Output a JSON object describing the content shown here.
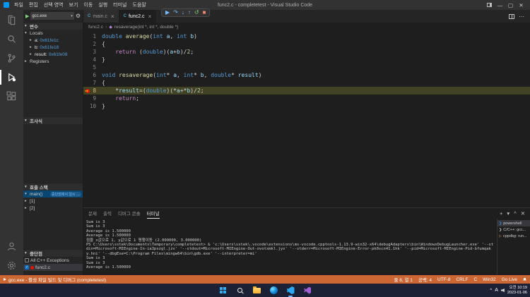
{
  "title_bar": {
    "menus": [
      "파일",
      "편집",
      "선택 영역",
      "보기",
      "이동",
      "실행",
      "터미널",
      "도움말"
    ],
    "title": "func2.c - completetest - Visual Studio Code"
  },
  "activity_bar": {
    "top": [
      {
        "name": "explorer",
        "active": false
      },
      {
        "name": "search",
        "active": false
      },
      {
        "name": "source-control",
        "active": false
      },
      {
        "name": "run-debug",
        "active": true
      },
      {
        "name": "extensions",
        "active": false
      }
    ],
    "bottom": [
      {
        "name": "account",
        "active": false
      },
      {
        "name": "settings",
        "active": false
      }
    ]
  },
  "debug_toolbar": {
    "buttons": [
      "continue",
      "step-over",
      "step-into",
      "step-out",
      "restart",
      "stop"
    ]
  },
  "sidebar": {
    "config": "gcc.exe",
    "variables": {
      "label": "변수",
      "locals_label": "Locals",
      "registers_label": "Registers",
      "locals": [
        {
          "name": "a",
          "value": "0x61fe1c"
        },
        {
          "name": "b",
          "value": "0x61fe18"
        },
        {
          "name": "result",
          "value": "0x61fe08"
        }
      ]
    },
    "watch": {
      "label": "조사식"
    },
    "call_stack": {
      "label": "호출 스택",
      "items": [
        {
          "label": "main()",
          "badge": "중단점에서 일시 중지됨",
          "selected": true
        },
        {
          "label": "[1]",
          "selected": false
        },
        {
          "label": "[2]",
          "selected": false
        }
      ]
    },
    "breakpoints": {
      "label": "중단점",
      "items": [
        {
          "label": "All C++ Exceptions",
          "checked": false,
          "dot": false,
          "selected": false
        },
        {
          "label": "func2.c",
          "checked": true,
          "dot": true,
          "selected": true
        }
      ]
    }
  },
  "editor": {
    "tabs": [
      {
        "label": "main.c",
        "active": false
      },
      {
        "label": "func2.c",
        "active": true
      }
    ],
    "breadcrumb": {
      "file": "func2.c",
      "symbol": "resaverage(int *, int *, double *)"
    },
    "code": {
      "current_line": 8,
      "breakpoint_line": 8,
      "lines": [
        [
          {
            "t": "double",
            "c": "kw"
          },
          {
            "t": " ",
            "c": "pl"
          },
          {
            "t": "average",
            "c": "fn"
          },
          {
            "t": "(",
            "c": "pl"
          },
          {
            "t": "int",
            "c": "kw"
          },
          {
            "t": " ",
            "c": "pl"
          },
          {
            "t": "a",
            "c": "var"
          },
          {
            "t": ", ",
            "c": "pl"
          },
          {
            "t": "int",
            "c": "kw"
          },
          {
            "t": " ",
            "c": "pl"
          },
          {
            "t": "b",
            "c": "var"
          },
          {
            "t": ")",
            "c": "pl"
          }
        ],
        [
          {
            "t": "{",
            "c": "pl"
          }
        ],
        [
          {
            "t": "    ",
            "c": "pl"
          },
          {
            "t": "return",
            "c": "ctrl"
          },
          {
            "t": " (",
            "c": "pl"
          },
          {
            "t": "double",
            "c": "kw"
          },
          {
            "t": ")(",
            "c": "pl"
          },
          {
            "t": "a",
            "c": "var"
          },
          {
            "t": "+",
            "c": "pl"
          },
          {
            "t": "b",
            "c": "var"
          },
          {
            "t": ")/",
            "c": "pl"
          },
          {
            "t": "2",
            "c": "num"
          },
          {
            "t": ";",
            "c": "pl"
          }
        ],
        [
          {
            "t": "}",
            "c": "pl"
          }
        ],
        [],
        [
          {
            "t": "void",
            "c": "kw"
          },
          {
            "t": " ",
            "c": "pl"
          },
          {
            "t": "resaverage",
            "c": "fn"
          },
          {
            "t": "(",
            "c": "pl"
          },
          {
            "t": "int",
            "c": "kw"
          },
          {
            "t": "* ",
            "c": "pl"
          },
          {
            "t": "a",
            "c": "var"
          },
          {
            "t": ", ",
            "c": "pl"
          },
          {
            "t": "int",
            "c": "kw"
          },
          {
            "t": "* ",
            "c": "pl"
          },
          {
            "t": "b",
            "c": "var"
          },
          {
            "t": ", ",
            "c": "pl"
          },
          {
            "t": "double",
            "c": "kw"
          },
          {
            "t": "* ",
            "c": "pl"
          },
          {
            "t": "result",
            "c": "var"
          },
          {
            "t": ")",
            "c": "pl"
          }
        ],
        [
          {
            "t": "{",
            "c": "pl"
          }
        ],
        [
          {
            "t": "    *",
            "c": "pl"
          },
          {
            "t": "result",
            "c": "var"
          },
          {
            "t": "=(",
            "c": "pl"
          },
          {
            "t": "double",
            "c": "kw"
          },
          {
            "t": ")(*",
            "c": "pl"
          },
          {
            "t": "a",
            "c": "var"
          },
          {
            "t": "+*",
            "c": "pl"
          },
          {
            "t": "b",
            "c": "var"
          },
          {
            "t": ")/",
            "c": "pl"
          },
          {
            "t": "2",
            "c": "num"
          },
          {
            "t": ";",
            "c": "pl"
          }
        ],
        [
          {
            "t": "    ",
            "c": "pl"
          },
          {
            "t": "return",
            "c": "ctrl"
          },
          {
            "t": ";",
            "c": "pl"
          }
        ],
        [
          {
            "t": "}",
            "c": "pl"
          }
        ]
      ]
    }
  },
  "panel": {
    "tabs": [
      {
        "label": "문제",
        "active": false
      },
      {
        "label": "출력",
        "active": false
      },
      {
        "label": "디버그 콘솔",
        "active": false
      },
      {
        "label": "터미널",
        "active": true
      }
    ],
    "terminal_lines": [
      "Sum is 3",
      "Sum is 3",
      "Average is 1.500000",
      "Average is 1.500000",
      "점을 x값으로 1, y값으로 1 평행이동 (2.000000, 3.000000)",
      "PS C:\\Users\\sstek\\Documents\\Temporary\\completetest> & 'c:\\Users\\sstek\\.vscode\\extensions\\ms-vscode.cpptools-1.13.9-win32-x64\\debugAdapters\\bin\\WindowsDebugLauncher.exe' '--stdin=Microsoft-MIEngine-In-ia3pszgl.jzv' '--stdout=Microsoft-MIEngine-Out-ovotxmkl.jyx' '--stderr=Microsoft-MIEngine-Error-pk0scn41.1hk' '--pid=Microsoft-MIEngine-Pid-bfumqaky.hni' '--dbgExe=C:\\Program Files\\mingw64\\bin\\gdb.exe' '--interpreter=mi'",
      "Sum is 3",
      "Sum is 3",
      "Average is 1.500000"
    ],
    "terminal_list": [
      {
        "label": "powershell",
        "icon": "terminal",
        "selected": true
      },
      {
        "label": "C/C++: gcc...",
        "icon": "tools",
        "selected": false
      },
      {
        "label": "cppdbg: run...",
        "icon": "debug",
        "selected": false
      }
    ]
  },
  "status_bar": {
    "left": "gcc.exe - 활성 파일 빌드 및 디버그 (completetest)",
    "right": [
      "줄 8, 열 1",
      "공백: 4",
      "UTF-8",
      "CRLF",
      "C",
      "Win32",
      "Go Live"
    ]
  },
  "taskbar": {
    "icons": [
      "start",
      "search",
      "file-explorer",
      "edge",
      "vscode",
      "visual-studio"
    ],
    "ime": "A",
    "time": "오전 10:19",
    "date": "2023-01-06"
  },
  "colors": {
    "accent": "#007acc",
    "statusbar_debug": "#cc6633",
    "breakpoint_red": "#e51400",
    "debug_line_highlight": "#414324"
  }
}
